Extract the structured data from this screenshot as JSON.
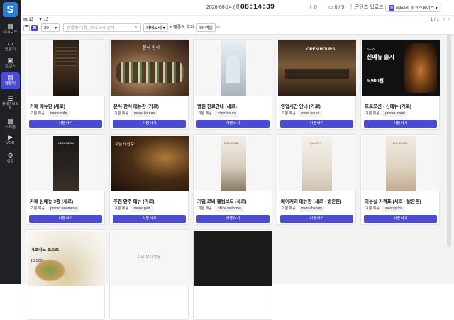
{
  "sidebar": {
    "logo": "S",
    "items": [
      {
        "label": "대시보드",
        "icon": "grid-icon"
      },
      {
        "label": "단말기",
        "icon": "monitor-icon"
      },
      {
        "label": "콘텐츠",
        "icon": "image-icon"
      },
      {
        "label": "템플릿",
        "icon": "template-icon",
        "active": true
      },
      {
        "label": "플레이리스트",
        "icon": "playlist-icon"
      },
      {
        "label": "스케줄",
        "icon": "calendar-icon"
      },
      {
        "label": "VOD",
        "icon": "video-icon"
      },
      {
        "label": "설정",
        "icon": "gear-icon"
      }
    ]
  },
  "header": {
    "date": "2026-08-24 (월)",
    "time": "08:14:39",
    "notif_count": "0",
    "device_status": "0 / 5",
    "upload_label": "콘텐츠 업로드",
    "workspace_badge": "W",
    "workspace": "wjlee의 워크스페이스"
  },
  "subheader": {
    "count_a": "13",
    "count_b": "13",
    "pager": "1 / 1"
  },
  "toolbar": {
    "page_size": "20",
    "search_placeholder": "템플릿 이름, 카테고리 검색",
    "category_label": "카테고리",
    "add_label": "+ 템플릿 추가",
    "sort_label": "액셀",
    "extra": "⊘"
  },
  "colors": {
    "accent": "#4b4bd9",
    "sidebar": "#202124"
  },
  "templates": [
    {
      "name": "카페 메뉴판 (세로)",
      "tag_basic": "기본 제공",
      "tag_key": "menu.cafe",
      "use": "사용하기"
    },
    {
      "name": "분식·한식 메뉴판 (가로)",
      "tag_basic": "기본 제공",
      "tag_key": "menu.korean",
      "use": "사용하기",
      "overlay": "분식·한식"
    },
    {
      "name": "병원 진료안내 (세로)",
      "tag_basic": "기본 제공",
      "tag_key": "clinic.hours",
      "use": "사용하기"
    },
    {
      "name": "영업시간 안내 (가로)",
      "tag_basic": "기본 제공",
      "tag_key": "store.hours",
      "use": "사용하기",
      "overlay": "OPEN HOURS"
    },
    {
      "name": "프로모션 · 신메뉴 (가로)",
      "tag_basic": "기본 제공",
      "tag_key": "promo.event",
      "use": "사용하기",
      "overlay_small": "NEW",
      "overlay": "신메뉴 출시",
      "overlay_price": "5,900원"
    },
    {
      "name": "카페 신메뉴 3종 (세로)",
      "tag_basic": "기본 제공",
      "tag_key": "promo.newmenu",
      "use": "사용하기",
      "overlay": "NEW MENU"
    },
    {
      "name": "주점 안주 메뉴 (가로)",
      "tag_basic": "기본 제공",
      "tag_key": "menu.pub",
      "use": "사용하기",
      "overlay": "오늘의 안주"
    },
    {
      "name": "기업 로비 웰컴보드 (세로)",
      "tag_basic": "기본 제공",
      "tag_key": "office.welcome",
      "use": "사용하기",
      "overlay": "WELCOME"
    },
    {
      "name": "베이커리 메뉴판 (세로 · 밝은톤)",
      "tag_basic": "기본 제공",
      "tag_key": "menu.bakery",
      "use": "사용하기",
      "overlay": "BAKERY"
    },
    {
      "name": "미용실 가격표 (세로 · 밝은톤)",
      "tag_basic": "기본 제공",
      "tag_key": "salon.price",
      "use": "사용하기",
      "overlay": "HAIR & NAIL"
    },
    {
      "name": "",
      "overlay": "아보카도 토스트",
      "overlay_price": "13,500"
    },
    {
      "name": "",
      "nopreview": "미리보기 없음"
    },
    {
      "name": ""
    }
  ]
}
